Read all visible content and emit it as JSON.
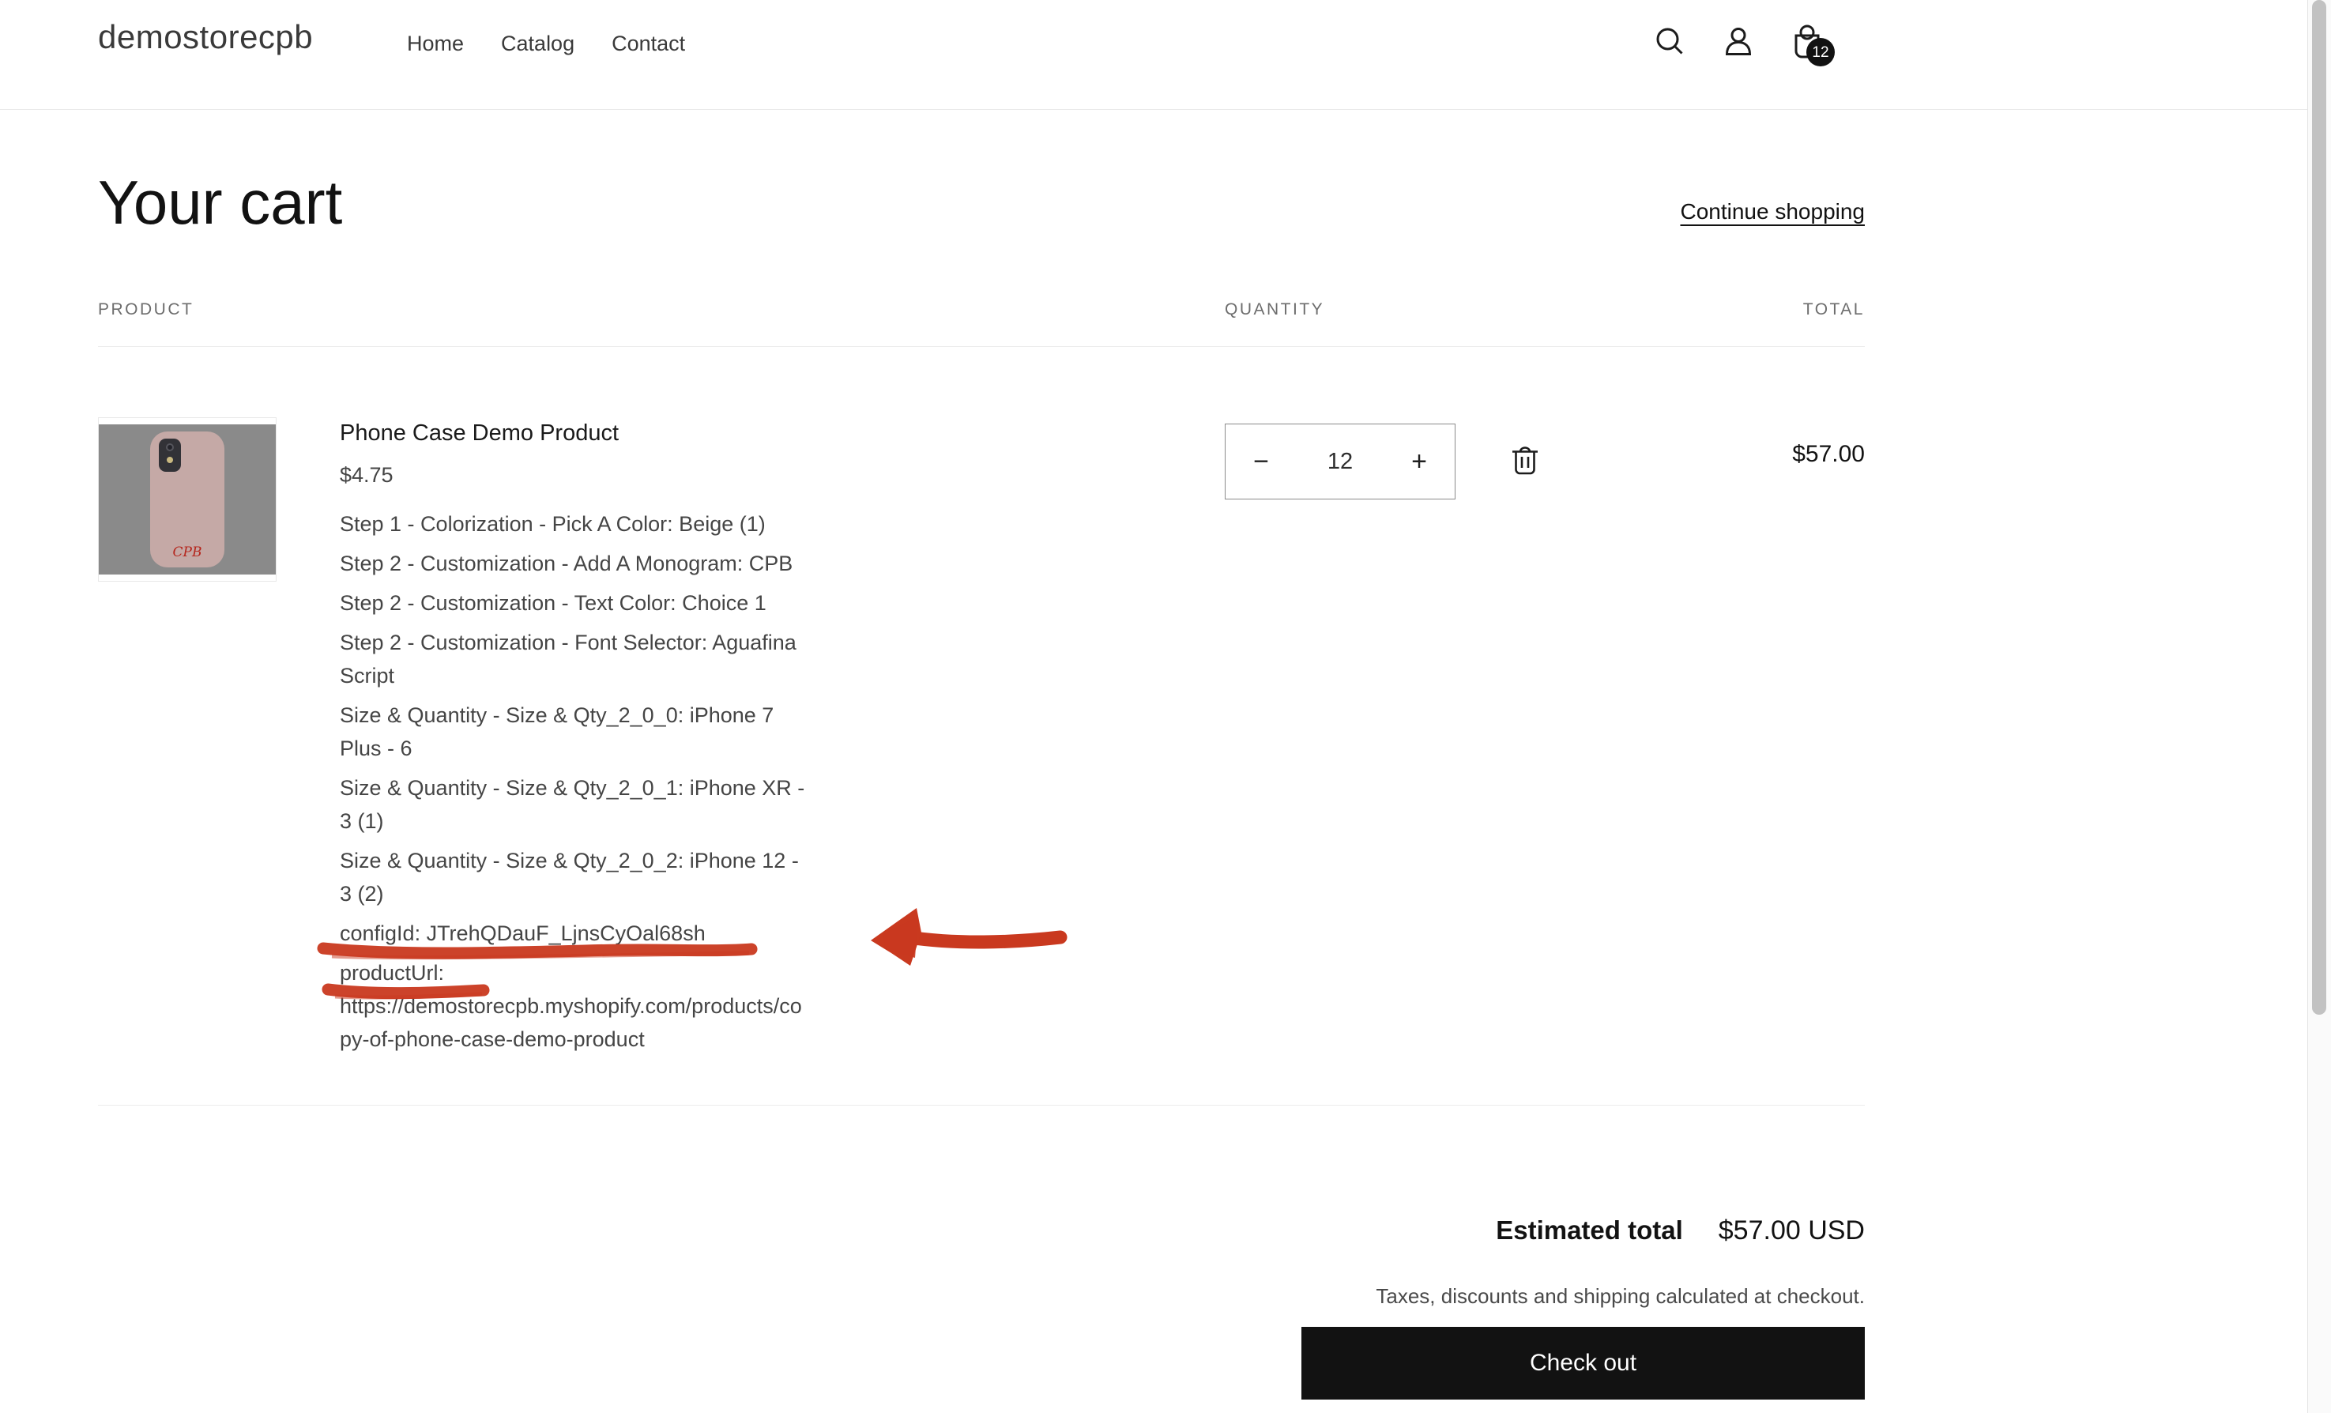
{
  "header": {
    "brand": "demostorecpb",
    "nav": [
      "Home",
      "Catalog",
      "Contact"
    ],
    "cart_count": "12"
  },
  "page": {
    "title": "Your cart",
    "continue_shopping": "Continue shopping"
  },
  "table": {
    "product_header": "PRODUCT",
    "quantity_header": "QUANTITY",
    "total_header": "TOTAL"
  },
  "item": {
    "name": "Phone Case Demo Product",
    "price": "$4.75",
    "options": [
      "Step 1 - Colorization - Pick A Color: Beige (1)",
      "Step 2 - Customization - Add A Monogram: CPB",
      "Step 2 - Customization - Text Color: Choice 1",
      "Step 2 - Customization - Font Selector: Aguafina Script",
      "Size & Quantity - Size & Qty_2_0_0: iPhone 7 Plus - 6",
      "Size & Quantity - Size & Qty_2_0_1: iPhone XR - 3 (1)",
      "Size & Quantity - Size & Qty_2_0_2: iPhone 12 - 3 (2)",
      "configId: JTrehQDauF_LjnsCyOal68sh",
      "productUrl: https://demostorecpb.myshopify.com/products/copy-of-phone-case-demo-product"
    ],
    "quantity": "12",
    "quantity_minus": "−",
    "quantity_plus": "+",
    "line_total": "$57.00",
    "thumbnail": {
      "monogram": "CPB",
      "monogram_color": "#b5251c",
      "bg_color": "#8a8a8a",
      "case_color": "#c5a9a6"
    }
  },
  "summary": {
    "estimated_total_label": "Estimated total",
    "estimated_total_value": "$57.00 USD",
    "taxes_note": "Taxes, discounts and shipping calculated at checkout.",
    "checkout_label": "Check out"
  },
  "annotations": {
    "color": "#c9391f"
  },
  "theme": {
    "checkout_bg": "#121212"
  }
}
